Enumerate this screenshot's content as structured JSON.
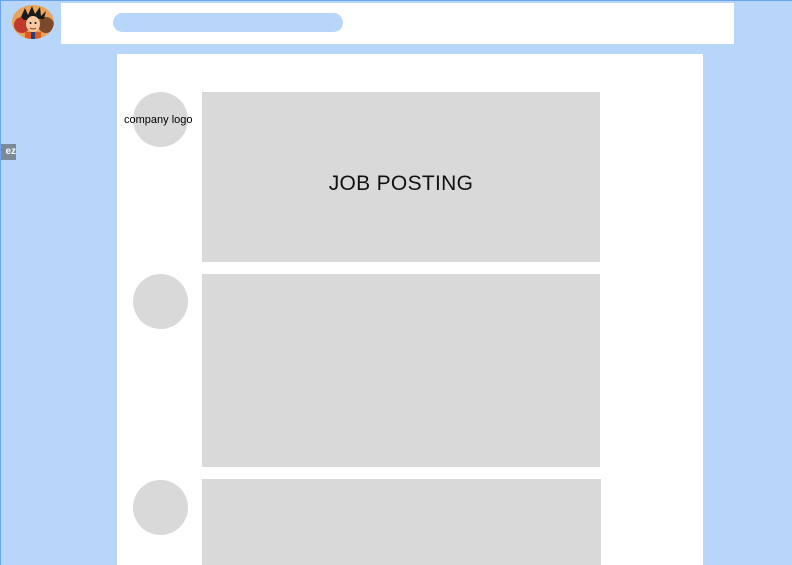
{
  "header": {
    "avatar_icon": "anime-character-avatar",
    "search": {
      "placeholder": "",
      "value": ""
    }
  },
  "side_tab": {
    "label": "ez"
  },
  "postings": [
    {
      "logo_label": "company logo",
      "title": "JOB POSTING"
    },
    {
      "logo_label": "",
      "title": ""
    },
    {
      "logo_label": "",
      "title": ""
    }
  ],
  "colors": {
    "background": "#b8d6f9",
    "placeholder_gray": "#d9d9d9",
    "panel": "#ffffff"
  }
}
